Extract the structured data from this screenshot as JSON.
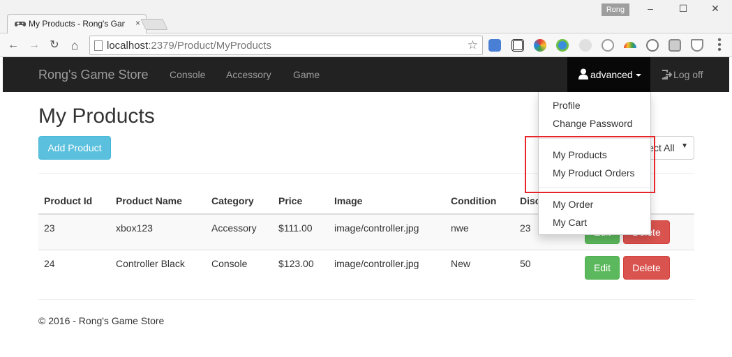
{
  "browser": {
    "tab_title": "My Products - Rong's Game Store",
    "close_glyph": "×",
    "user_badge": "Rong",
    "window_controls": [
      "–",
      "☐",
      "✕"
    ],
    "url_host": "localhost",
    "url_path": ":2379/Product/MyProducts",
    "back_glyph": "←",
    "forward_glyph": "→",
    "reload_glyph": "↻",
    "home_glyph": "⌂",
    "star_glyph": "☆",
    "extension_icons": [
      "translate-icon",
      "qr-code-icon",
      "color-wheel-icon",
      "globe-icon",
      "feather-icon",
      "gear-icon",
      "rainbow-icon",
      "compass-icon",
      "cube-icon",
      "shield-icon"
    ]
  },
  "navbar": {
    "brand": "Rong's Game Store",
    "links": [
      "Console",
      "Accessory",
      "Game"
    ],
    "user_label": "advanced",
    "logoff_label": "Log off"
  },
  "page": {
    "title": "My Products",
    "add_button": "Add Product",
    "select_value": "Select All",
    "select_arrow": "▼"
  },
  "table": {
    "headers": [
      "Product Id",
      "Product Name",
      "Category",
      "Price",
      "Image",
      "Condition",
      "Disc"
    ],
    "rows": [
      {
        "id": "23",
        "name": "xbox123",
        "category": "Accessory",
        "price": "$111.00",
        "image": "image/controller.jpg",
        "condition": "nwe",
        "disc": "23",
        "edit": "Edit",
        "delete": "Delete"
      },
      {
        "id": "24",
        "name": "Controller Black",
        "category": "Console",
        "price": "$123.00",
        "image": "image/controller.jpg",
        "condition": "New",
        "disc": "50",
        "edit": "Edit",
        "delete": "Delete"
      }
    ]
  },
  "dropdown": {
    "items": [
      "Profile",
      "Change Password",
      "My Products",
      "My Product Orders",
      "My Order",
      "My Cart"
    ]
  },
  "footer": {
    "text": "© 2016 - Rong's Game Store"
  },
  "colors": {
    "navbar_bg": "#222222",
    "info": "#5bc0de",
    "success": "#5cb85c",
    "danger": "#d9534f",
    "highlight": "#e8242b"
  }
}
